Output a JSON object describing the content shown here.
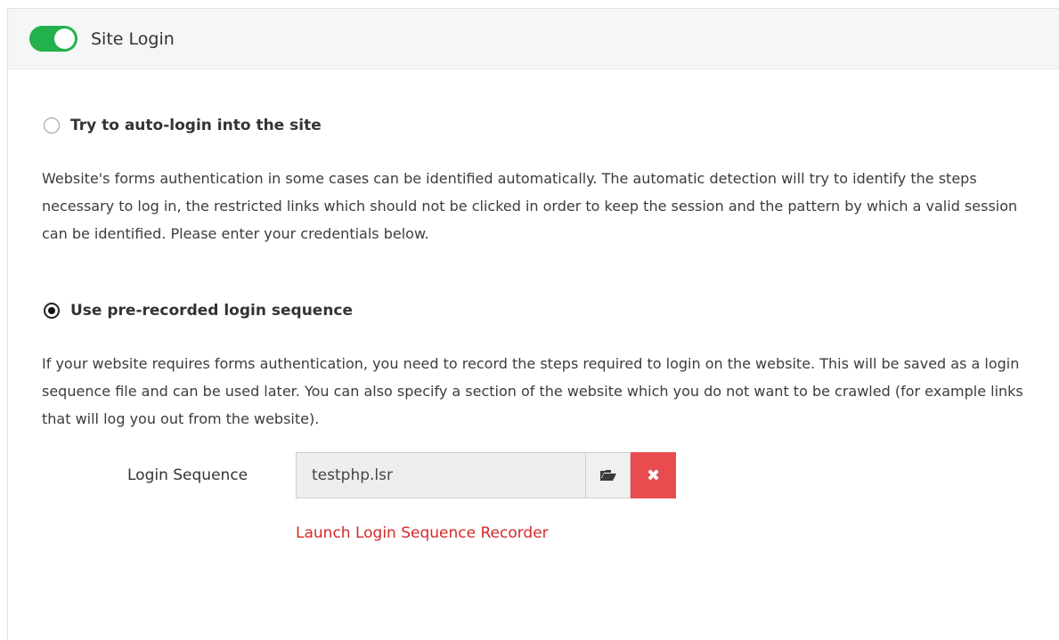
{
  "header": {
    "toggle_on": true,
    "title": "Site Login"
  },
  "auto_login": {
    "label": "Try to auto-login into the site",
    "checked": false,
    "description": "Website's forms authentication in some cases can be identified automatically. The automatic detection will try to identify the steps necessary to log in, the restricted links which should not be clicked in order to keep the session and the pattern by which a valid session can be identified. Please enter your credentials below."
  },
  "prerecorded": {
    "label": "Use pre-recorded login sequence",
    "checked": true,
    "description": "If your website requires forms authentication, you need to record the steps required to login on the website. This will be saved as a login sequence file and can be used later. You can also specify a section of the website which you do not want to be crawled (for example links that will log you out from the website)."
  },
  "login_sequence": {
    "label": "Login Sequence",
    "value": "testphp.lsr",
    "browse_icon": "folder-open-icon",
    "clear_icon": "close-icon",
    "clear_glyph": "✖",
    "launch_link": "Launch Login Sequence Recorder"
  },
  "colors": {
    "toggle_accent": "#22b14c",
    "danger": "#e84c4f",
    "link": "#d32a2a"
  }
}
